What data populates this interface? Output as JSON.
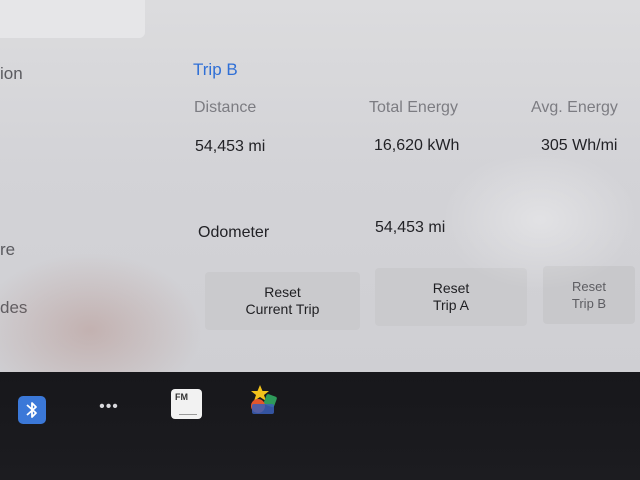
{
  "side_labels": [
    "ion",
    "re",
    "des"
  ],
  "trip": {
    "title": "Trip B",
    "headers": {
      "distance": "Distance",
      "total_energy": "Total Energy",
      "avg_energy": "Avg. Energy"
    },
    "values": {
      "distance": "54,453 mi",
      "total_energy": "16,620 kWh",
      "avg_energy": "305 Wh/mi"
    },
    "odometer_label": "Odometer",
    "odometer_value": "54,453 mi"
  },
  "buttons": {
    "reset_current": "Reset\nCurrent Trip",
    "reset_a": "Reset\nTrip A",
    "reset_b": "Reset\nTrip B"
  },
  "taskbar": {
    "dots": "•••",
    "fm_label": "FM"
  },
  "colors": {
    "accent": "#2f6fd6",
    "bluetooth": "#3b78d8"
  }
}
